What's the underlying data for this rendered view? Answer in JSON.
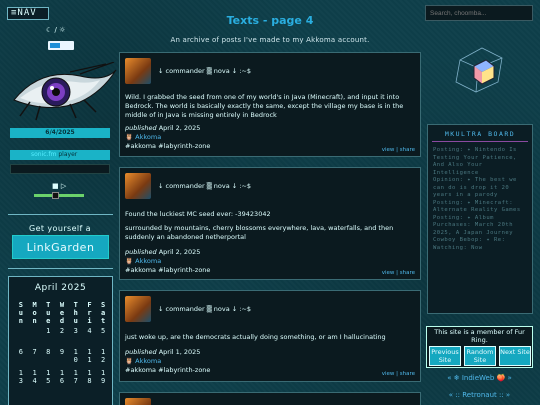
{
  "nav_button": "≡NAV",
  "theme_modes": "☾ / ☼",
  "date": "6/4/2025",
  "player": {
    "prefix": "sonic.fm",
    "label": "player",
    "controls": "■ ▷"
  },
  "linkgarden": {
    "heading": "Get yourself a",
    "button": "LinkGarden"
  },
  "calendar": {
    "title": "April 2025",
    "days": [
      "Sun",
      "Mon",
      "Tue",
      "Wed",
      "Thu",
      "Fri",
      "Sat"
    ],
    "weeks": [
      [
        "",
        "",
        "1",
        "2",
        "3",
        "4",
        "5"
      ],
      [
        "6",
        "7",
        "8",
        "9",
        "10",
        "11",
        "12"
      ],
      [
        "13",
        "14",
        "15",
        "16",
        "17",
        "18",
        "19"
      ]
    ]
  },
  "search": {
    "placeholder": "Search, choomba..."
  },
  "main": {
    "title": "Texts - page 4",
    "subtitle": "An archive of posts I've made to my Akkoma account.",
    "posts": [
      {
        "header": "↓ commander ▒ nova ↓ :~$",
        "body": "Wild. I grabbed the seed from one of my world's in Java (Minecraft), and input it into Bedrock. The world is basically exactly the same, except the village my base is in the middle of in Java is missing entirely in Bedrock",
        "published_label": "published",
        "date": "April 2, 2025",
        "account": "🦉 Akkoma",
        "tags": "#akkoma #labyrinth-zone",
        "view": "view",
        "share": "share"
      },
      {
        "header": "↓ commander ▒ nova ↓ :~$",
        "body1": "Found the luckiest MC seed ever: -39423042",
        "body2": "surrounded by mountains, cherry blossoms everywhere, lava, waterfalls, and then suddenly an abandoned netherportal",
        "published_label": "published",
        "date": "April 2, 2025",
        "account": "🦉 Akkoma",
        "tags": "#akkoma #labyrinth-zone",
        "view": "view",
        "share": "share"
      },
      {
        "header": "↓ commander ▒ nova ↓ :~$",
        "body": "just woke up, are the democrats actually doing something, or am I hallucinating",
        "published_label": "published",
        "date": "April 1, 2025",
        "account": "🦉 Akkoma",
        "tags": "#akkoma #labyrinth-zone",
        "view": "view",
        "share": "share"
      }
    ]
  },
  "mkultra": {
    "heading": "MKULTRA BOARD",
    "lines": [
      "Posting: ✦ Nintendo Is Testing Your Patience, And Also Your Intelligence",
      "Opinion: ✦ The best we can do is drop it 20 years in a parody",
      "Posting: ✦ Minecraft: Alternate Reality Games",
      "Posting: ✦ Album Purchases: March 20th 2025, A Japan Journey",
      "Cowboy Bebop: ✦ Re: Watching: Now"
    ]
  },
  "fur_ring": {
    "text": "This site is a member of Fur Ring.",
    "prev": "Previous Site",
    "random": "Random Site",
    "next": "Next Site"
  },
  "indieweb": "« ❄ IndieWeb 🍑 »",
  "retronaut": "« :: Retronaut :: »"
}
